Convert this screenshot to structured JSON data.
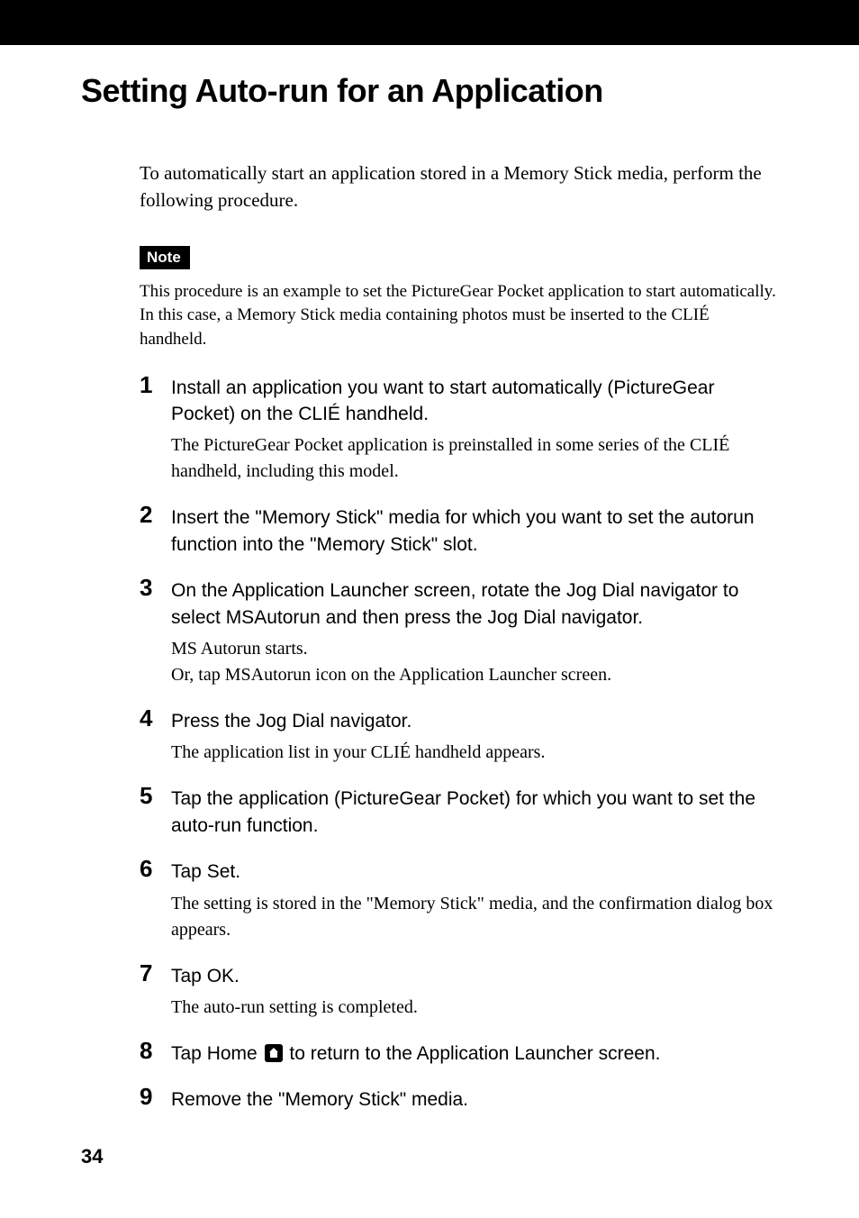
{
  "page": {
    "title": "Setting Auto-run for an Application",
    "intro": "To automatically start an application stored in a Memory Stick media, perform the following procedure.",
    "note_label": "Note",
    "note_text": "This procedure is an example to set the PictureGear Pocket application to start automatically. In this case, a Memory Stick media containing photos must be inserted to the CLIÉ handheld.",
    "steps": [
      {
        "num": "1",
        "title": "Install an application you want to start automatically (PictureGear Pocket) on the CLIÉ handheld.",
        "body": "The PictureGear Pocket application is preinstalled in some series of the CLIÉ handheld, including this model."
      },
      {
        "num": "2",
        "title": "Insert the \"Memory Stick\" media for which you want to set the autorun function into the \"Memory Stick\" slot.",
        "body": ""
      },
      {
        "num": "3",
        "title": "On the Application Launcher screen, rotate the Jog Dial navigator to select MSAutorun and then press the Jog Dial navigator.",
        "body": "MS Autorun starts.\nOr, tap MSAutorun icon on the Application Launcher screen."
      },
      {
        "num": "4",
        "title": "Press the Jog Dial navigator.",
        "body": "The application list in your CLIÉ handheld appears."
      },
      {
        "num": "5",
        "title": "Tap the application (PictureGear Pocket) for which you want to set the auto-run function.",
        "body": ""
      },
      {
        "num": "6",
        "title": "Tap Set.",
        "body": "The setting is stored in the \"Memory Stick\" media, and the confirmation dialog box appears."
      },
      {
        "num": "7",
        "title": "Tap OK.",
        "body": "The auto-run setting is completed."
      },
      {
        "num": "8",
        "title_pre": "Tap Home ",
        "title_post": " to return to the Application Launcher screen.",
        "icon": "home-icon",
        "body": ""
      },
      {
        "num": "9",
        "title": "Remove the \"Memory Stick\" media.",
        "body": ""
      }
    ],
    "page_number": "34"
  }
}
